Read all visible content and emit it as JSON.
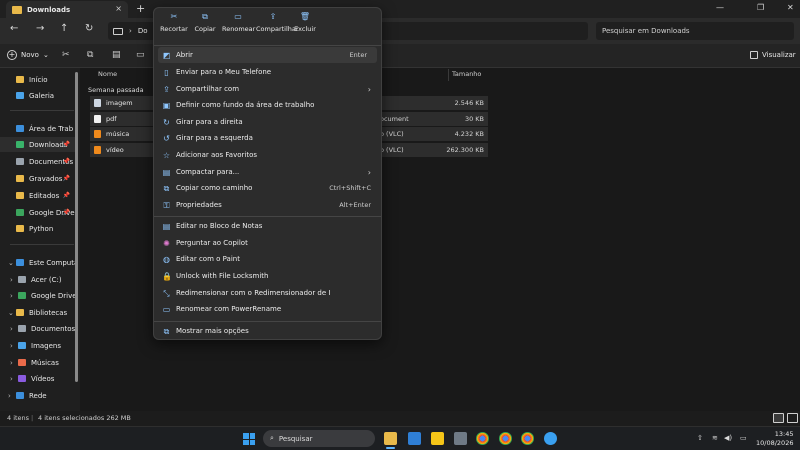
{
  "window": {
    "tab_title": "Downloads",
    "tab_close": "×",
    "new_tab": "+",
    "controls": [
      "—",
      "❐",
      "✕"
    ]
  },
  "addressbar": {
    "back": "←",
    "forward": "→",
    "up": "↑",
    "refresh": "↻",
    "chevron": "›",
    "location": "Do",
    "search_placeholder": "Pesquisar em Downloads"
  },
  "commandbar": {
    "new_label": "Novo",
    "new_chevron": "⌄",
    "view_label": "Visualizar"
  },
  "sidebar": {
    "items": [
      {
        "label": "Início",
        "icon": "home-icon",
        "color": "#e9b94a"
      },
      {
        "label": "Galeria",
        "icon": "gallery-icon",
        "color": "#4aa3e9"
      },
      {
        "label": "Área de Trab",
        "icon": "desktop-icon",
        "color": "#3c8fdc"
      },
      {
        "label": "Downloads",
        "icon": "download-icon",
        "color": "#39b36a"
      },
      {
        "label": "Documentos",
        "icon": "documents-icon",
        "color": "#9aa3ad"
      },
      {
        "label": "Gravados",
        "icon": "folder-icon",
        "color": "#e9b94a"
      },
      {
        "label": "Editados",
        "icon": "folder-icon",
        "color": "#e9b94a"
      },
      {
        "label": "Google Drive",
        "icon": "google-drive-icon",
        "color": "#3ba55d"
      },
      {
        "label": "Python",
        "icon": "folder-icon",
        "color": "#e9b94a"
      },
      {
        "label": "Este Computador",
        "icon": "computer-icon",
        "color": "#3c8fdc"
      },
      {
        "label": "Acer (C:)",
        "icon": "drive-icon",
        "color": "#9aa3ad"
      },
      {
        "label": "Google Drive (",
        "icon": "google-drive-icon",
        "color": "#3ba55d"
      },
      {
        "label": "Bibliotecas",
        "icon": "libraries-icon",
        "color": "#e9b94a"
      },
      {
        "label": "Documentos",
        "icon": "documents-icon",
        "color": "#9aa3ad"
      },
      {
        "label": "Imagens",
        "icon": "pictures-icon",
        "color": "#4aa3e9"
      },
      {
        "label": "Músicas",
        "icon": "music-icon",
        "color": "#e96a4a"
      },
      {
        "label": "Vídeos",
        "icon": "videos-icon",
        "color": "#8a5be0"
      },
      {
        "label": "Rede",
        "icon": "network-icon",
        "color": "#3c8fdc"
      }
    ]
  },
  "filelist": {
    "columns": [
      "Nome",
      "Tamanho"
    ],
    "group": "Semana passada",
    "files": [
      {
        "name": "imagem",
        "type": "",
        "size": "2.546 KB",
        "icon_color": "#cfd8e3"
      },
      {
        "name": "pdf",
        "type": "ocument",
        "size": "30 KB",
        "icon_color": "#f2f2f2"
      },
      {
        "name": "música",
        "type": "o (VLC)",
        "size": "4.232 KB",
        "icon_color": "#f08a1c"
      },
      {
        "name": "vídeo",
        "type": "o (VLC)",
        "size": "262.300 KB",
        "icon_color": "#f08a1c"
      }
    ]
  },
  "context_menu": {
    "quick_actions": [
      {
        "label": "Recortar",
        "icon": "cut-icon",
        "glyph": "✂"
      },
      {
        "label": "Copiar",
        "icon": "copy-icon",
        "glyph": "⧉"
      },
      {
        "label": "Renomear",
        "icon": "rename-icon",
        "glyph": "▭"
      },
      {
        "label": "Compartilhar",
        "icon": "share-icon",
        "glyph": "⇪"
      },
      {
        "label": "Excluir",
        "icon": "delete-icon",
        "glyph": "🗑"
      }
    ],
    "items": [
      {
        "label": "Abrir",
        "shortcut": "Enter",
        "icon": "open-icon",
        "glyph": "◩"
      },
      {
        "label": "Enviar para o Meu Telefone",
        "shortcut": "",
        "icon": "phone-icon",
        "glyph": "▯"
      },
      {
        "label": "Compartilhar com",
        "shortcut": "›",
        "icon": "share-with-icon",
        "glyph": "⇪"
      },
      {
        "label": "Definir como fundo da área de trabalho",
        "shortcut": "",
        "icon": "wallpaper-icon",
        "glyph": "▣"
      },
      {
        "label": "Girar para a direita",
        "shortcut": "",
        "icon": "rotate-right-icon",
        "glyph": "↻"
      },
      {
        "label": "Girar para a esquerda",
        "shortcut": "",
        "icon": "rotate-left-icon",
        "glyph": "↺"
      },
      {
        "label": "Adicionar aos Favoritos",
        "shortcut": "",
        "icon": "star-icon",
        "glyph": "☆"
      },
      {
        "label": "Compactar para...",
        "shortcut": "›",
        "icon": "zip-icon",
        "glyph": "▤"
      },
      {
        "label": "Copiar como caminho",
        "shortcut": "Ctrl+Shift+C",
        "icon": "copy-path-icon",
        "glyph": "⧉"
      },
      {
        "label": "Propriedades",
        "shortcut": "Alt+Enter",
        "icon": "properties-icon",
        "glyph": "⚿"
      },
      {
        "label": "Editar no Bloco de Notas",
        "shortcut": "",
        "icon": "notepad-icon",
        "glyph": "▤"
      },
      {
        "label": "Perguntar ao Copilot",
        "shortcut": "",
        "icon": "copilot-icon",
        "glyph": "✺"
      },
      {
        "label": "Editar com o Paint",
        "shortcut": "",
        "icon": "paint-icon",
        "glyph": "◍"
      },
      {
        "label": "Unlock with File Locksmith",
        "shortcut": "",
        "icon": "lock-icon",
        "glyph": "🔒"
      },
      {
        "label": "Redimensionar com o Redimensionador de I",
        "shortcut": "",
        "icon": "resize-icon",
        "glyph": "⤡"
      },
      {
        "label": "Renomear com PowerRename",
        "shortcut": "",
        "icon": "power-rename-icon",
        "glyph": "▭"
      },
      {
        "label": "Mostrar mais opções",
        "shortcut": "",
        "icon": "more-options-icon",
        "glyph": "⧉"
      }
    ]
  },
  "statusbar": {
    "count": "4 itens",
    "selection": "4 itens selecionados  262 MB"
  },
  "taskbar": {
    "search_placeholder": "Pesquisar",
    "time": "13:45",
    "date": "10/08/2026",
    "lang": "⇧",
    "wifi": "≋",
    "volume": "◀)",
    "battery": "▭"
  }
}
